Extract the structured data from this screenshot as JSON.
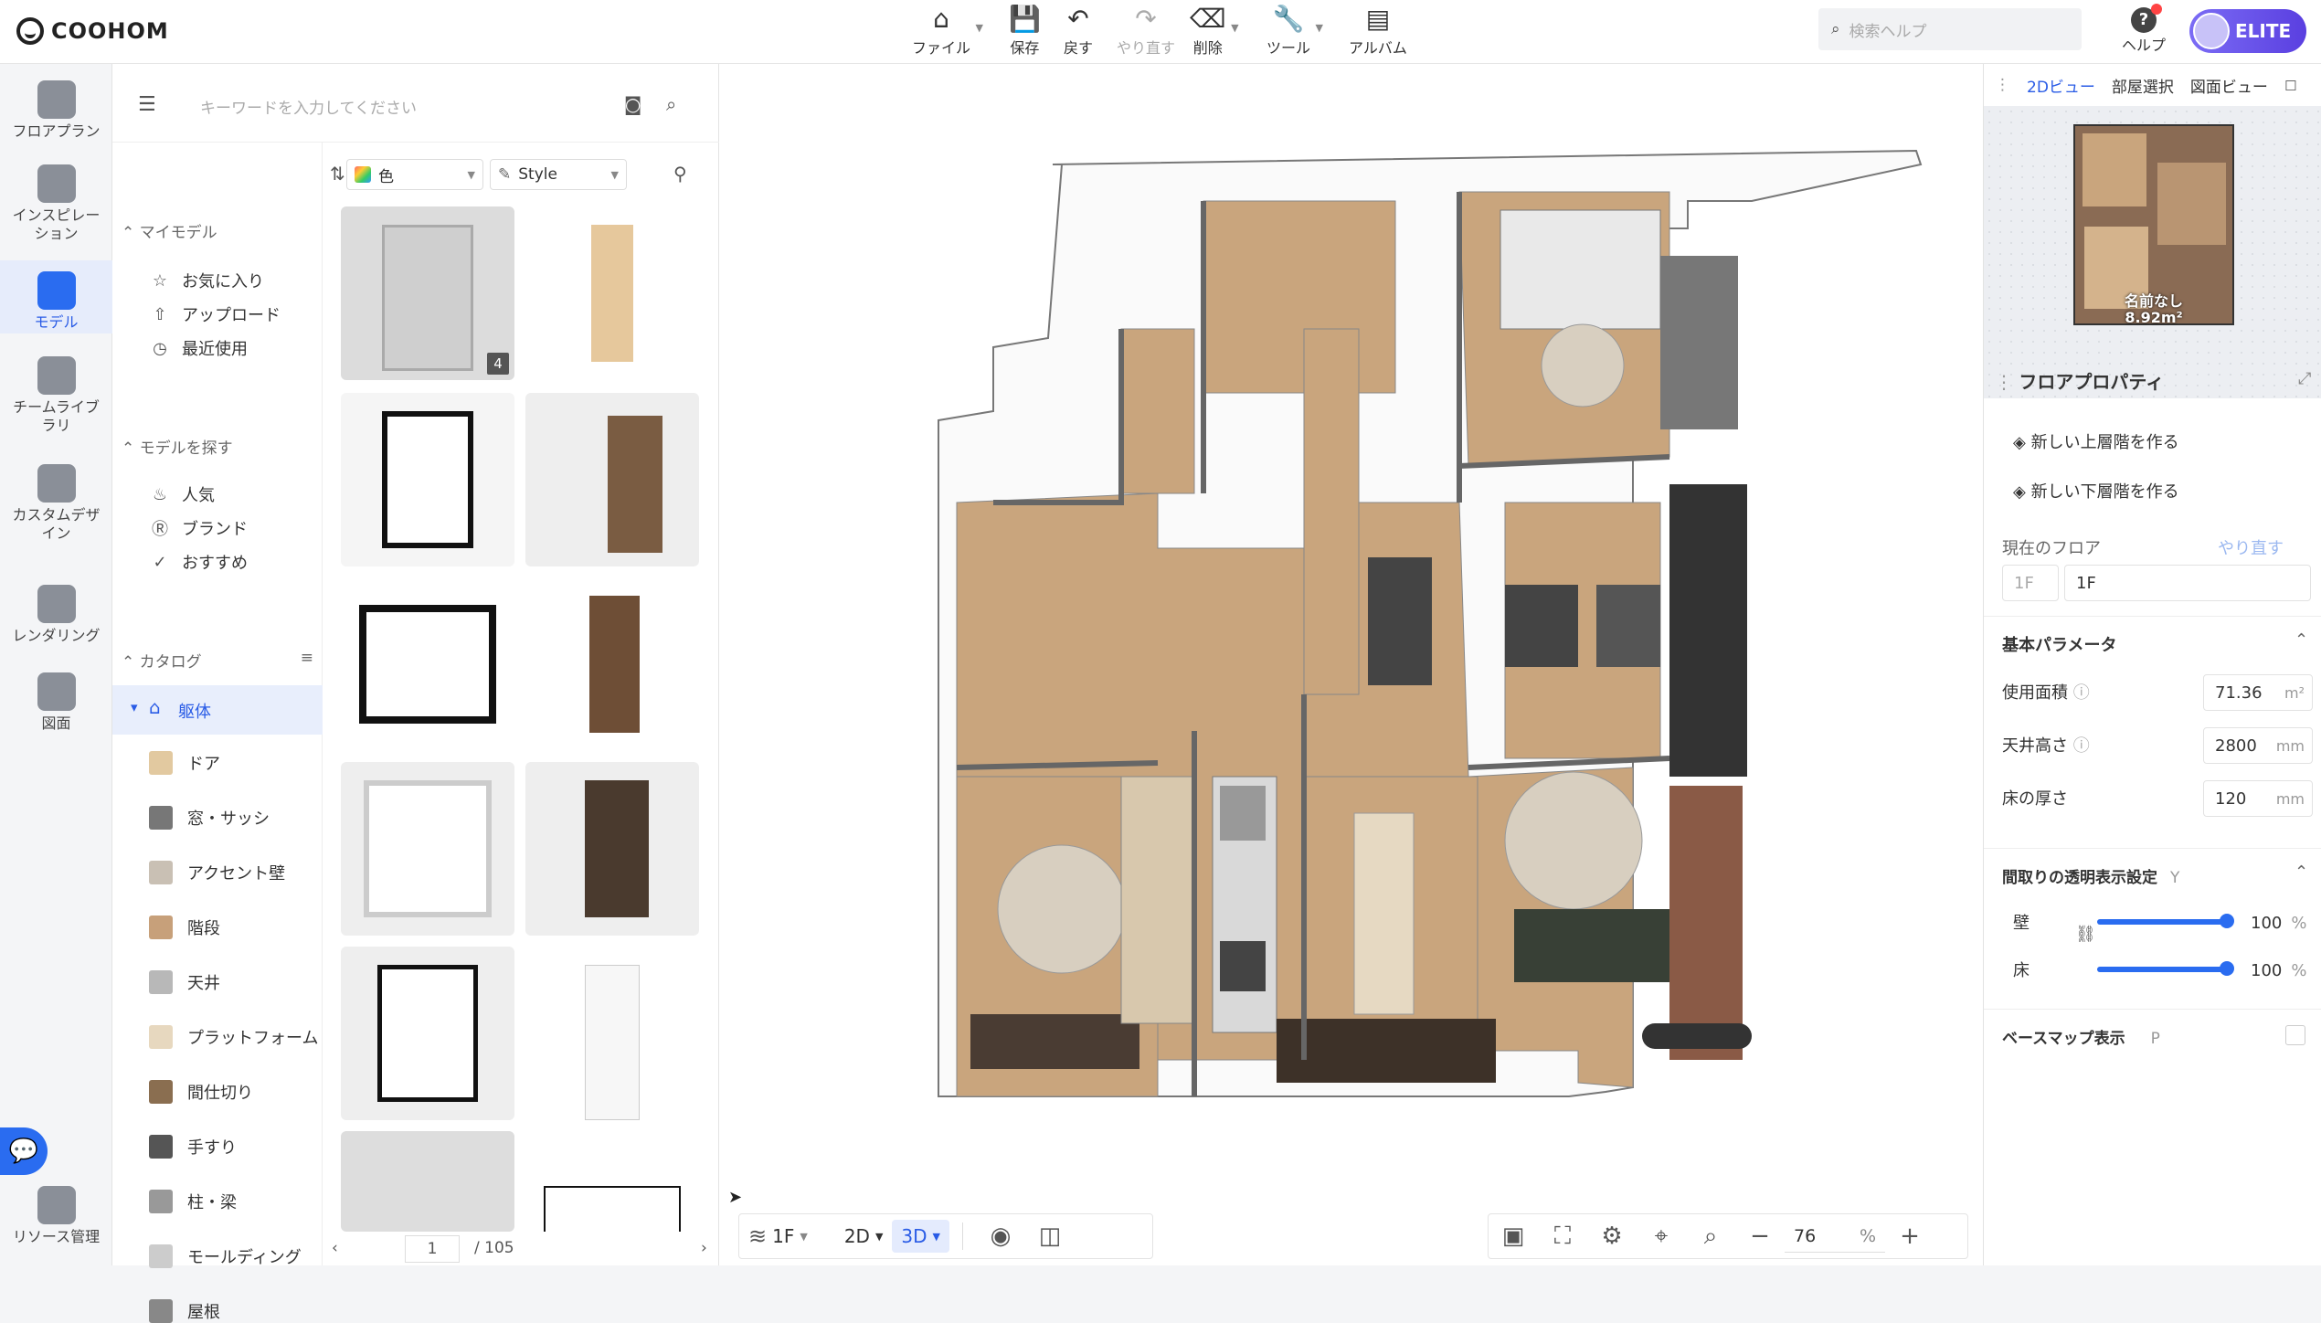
{
  "app": {
    "logo": "COOHOM"
  },
  "toolbar": [
    {
      "label": "ファイル",
      "icon": "file-icon",
      "glyph": "⌂",
      "caret": true,
      "disabled": false
    },
    {
      "label": "保存",
      "icon": "save-icon",
      "glyph": "💾",
      "caret": false,
      "disabled": false
    },
    {
      "label": "戻す",
      "icon": "undo-icon",
      "glyph": "↶",
      "caret": false,
      "disabled": false
    },
    {
      "label": "やり直す",
      "icon": "redo-icon",
      "glyph": "↷",
      "caret": false,
      "disabled": true
    },
    {
      "label": "削除",
      "icon": "eraser-icon",
      "glyph": "⌫",
      "caret": true,
      "disabled": false
    },
    {
      "label": "ツール",
      "icon": "wrench-icon",
      "glyph": "🔧",
      "caret": true,
      "disabled": false
    },
    {
      "label": "アルバム",
      "icon": "album-icon",
      "glyph": "▤",
      "caret": false,
      "disabled": false
    }
  ],
  "search": {
    "placeholder": "検索ヘルプ"
  },
  "help": {
    "label": "ヘルプ"
  },
  "account": {
    "badge": "ELITE"
  },
  "leftnav": [
    {
      "label": "フロアプラン",
      "icon": "floorplan-icon",
      "active": false
    },
    {
      "label": "インスピレーション",
      "icon": "inspiration-icon",
      "active": false
    },
    {
      "label": "モデル",
      "icon": "model-sofa-icon",
      "active": true
    },
    {
      "label": "チームライブラリ",
      "icon": "team-library-icon",
      "active": false
    },
    {
      "label": "カスタムデザイン",
      "icon": "custom-design-icon",
      "active": false
    },
    {
      "label": "レンダリング",
      "icon": "rendering-camera-icon",
      "active": false
    },
    {
      "label": "図面",
      "icon": "drawing-icon",
      "active": false
    },
    {
      "label": "リソース管理",
      "icon": "resource-icon",
      "active": false
    }
  ],
  "catalog": {
    "keyword_placeholder": "キーワードを入力してください",
    "section_my": "マイモデル",
    "my_items": [
      {
        "label": "お気に入り",
        "glyph": "☆"
      },
      {
        "label": "アップロード",
        "glyph": "⇧"
      },
      {
        "label": "最近使用",
        "glyph": "◷"
      }
    ],
    "section_find": "モデルを探す",
    "find_items": [
      {
        "label": "人気",
        "glyph": "♨"
      },
      {
        "label": "ブランド",
        "glyph": "Ⓡ"
      },
      {
        "label": "おすすめ",
        "glyph": "✓"
      }
    ],
    "section_catalog": "カタログ",
    "active_category": "躯体",
    "sub_items": [
      {
        "label": "ドア",
        "color": "#e2c9a0"
      },
      {
        "label": "窓・サッシ",
        "color": "#777"
      },
      {
        "label": "アクセント壁",
        "color": "#c9c0b4"
      },
      {
        "label": "階段",
        "color": "#c7a07a"
      },
      {
        "label": "天井",
        "color": "#b8b8b8"
      },
      {
        "label": "プラットフォーム",
        "color": "#e7d8bf"
      },
      {
        "label": "間仕切り",
        "color": "#8a6e50"
      },
      {
        "label": "手すり",
        "color": "#555"
      },
      {
        "label": "柱・梁",
        "color": "#999"
      },
      {
        "label": "モールディング",
        "color": "#ccc"
      },
      {
        "label": "屋根",
        "color": "#888"
      }
    ],
    "filters": {
      "color": "色",
      "style": "Style"
    },
    "first_thumb_badge": "4",
    "pagination": {
      "current": "1",
      "total": "/ 105"
    }
  },
  "rightpanel": {
    "tabs": [
      "2Dビュー",
      "部屋選択",
      "図面ビュー"
    ],
    "minimap": {
      "room_name": "名前なし",
      "area": "8.92m²"
    },
    "title": "フロアプロパティ",
    "actions": [
      "新しい上層階を作る",
      "新しい下層階を作る"
    ],
    "current_floor_label": "現在のフロア",
    "current_floor_link": "やり直す",
    "floor_select": "1F",
    "floor_name": "1F",
    "basic_params": "基本パラメータ",
    "params": [
      {
        "label": "使用面積",
        "value": "71.36",
        "unit": "m²"
      },
      {
        "label": "天井高さ",
        "value": "2800",
        "unit": "mm"
      },
      {
        "label": "床の厚さ",
        "value": "120",
        "unit": "mm"
      }
    ],
    "transparency": {
      "title": "間取りの透明表示設定",
      "key": "Y",
      "rows": [
        {
          "label": "壁",
          "value": "100",
          "unit": "%",
          "level": 1.0
        },
        {
          "label": "床",
          "value": "100",
          "unit": "%",
          "level": 1.0
        }
      ]
    },
    "basemap": {
      "label": "ベースマップ表示",
      "key": "P"
    }
  },
  "bottom": {
    "floor": "1F",
    "view2d": "2D",
    "view3d": "3D",
    "zoom": "76",
    "zoom_unit": "%"
  }
}
